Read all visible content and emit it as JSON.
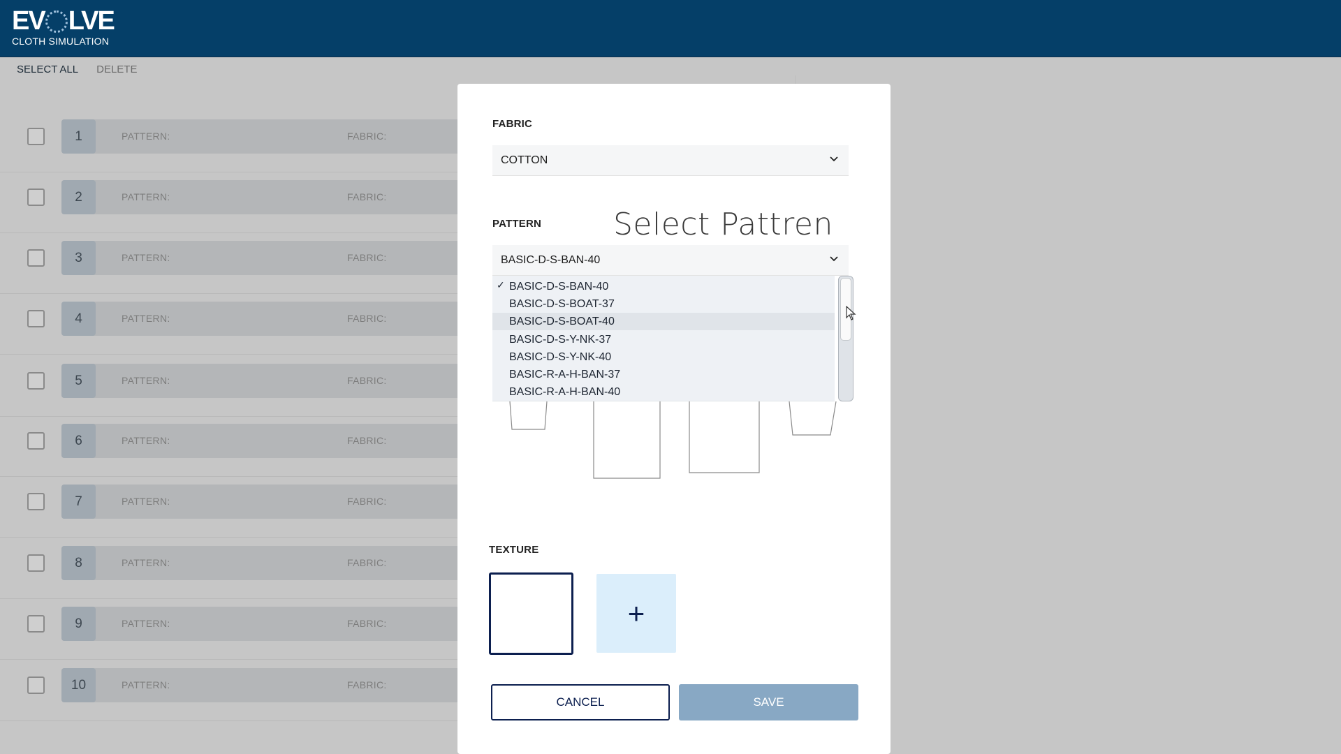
{
  "app": {
    "logo_main": "EVOLVE",
    "logo_prefix": "EV",
    "logo_suffix": "LVE",
    "logo_sub": "CLOTH SIMULATION",
    "brand_color": "#053f68"
  },
  "toolbar": {
    "select_all": "SELECT ALL",
    "delete": "DELETE"
  },
  "list": {
    "pattern_label": "PATTERN:",
    "fabric_label": "FABRIC:",
    "rows": [
      "1",
      "2",
      "3",
      "4",
      "5",
      "6",
      "7",
      "8",
      "9",
      "10"
    ]
  },
  "modal": {
    "fabric_label": "FABRIC",
    "fabric_value": "COTTON",
    "pattern_label": "PATTERN",
    "pattern_value": "BASIC-D-S-BAN-40",
    "callout": "Select Pattren",
    "pattern_options": [
      "BASIC-D-S-BAN-40",
      "BASIC-D-S-BOAT-37",
      "BASIC-D-S-BOAT-40",
      "BASIC-D-S-Y-NK-37",
      "BASIC-D-S-Y-NK-40",
      "BASIC-R-A-H-BAN-37",
      "BASIC-R-A-H-BAN-40"
    ],
    "selected_option": "BASIC-D-S-BAN-40",
    "hovered_option": "BASIC-D-S-BOAT-40",
    "texture_label": "TEXTURE",
    "add_texture_symbol": "+",
    "cancel_label": "CANCEL",
    "save_label": "SAVE"
  }
}
